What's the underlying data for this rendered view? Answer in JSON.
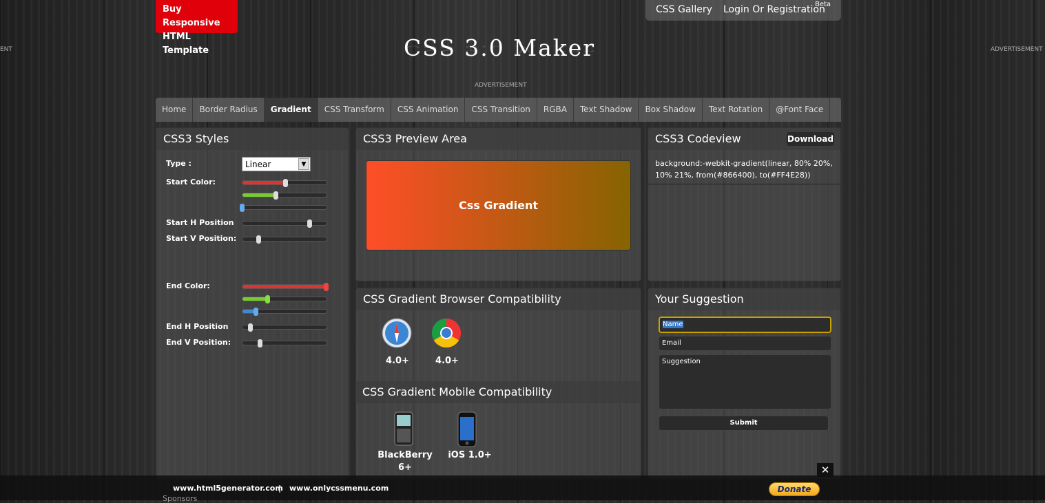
{
  "top": {
    "buy_line1": "Buy Responsive",
    "buy_line2": "HTML Template",
    "gallery": "CSS Gallery",
    "login": "Login Or Registration",
    "beta": "Beta"
  },
  "logo": {
    "text": "CSS 3.0 Maker"
  },
  "ads": {
    "center": "ADVERTISEMENT",
    "right": "ADVERTISEMENT",
    "left": "ENT"
  },
  "nav": {
    "items": [
      "Home",
      "Border Radius",
      "Gradient",
      "CSS Transform",
      "CSS Animation",
      "CSS Transition",
      "RGBA",
      "Text Shadow",
      "Box Shadow",
      "Text Rotation",
      "@Font Face"
    ],
    "active": "Gradient"
  },
  "styles_panel": {
    "title": "CSS3 Styles",
    "type_label": "Type :",
    "type_value": "Linear",
    "start_color_label": "Start Color:",
    "start_h_label": "Start H Position",
    "start_v_label": "Start V Position:",
    "end_color_label": "End Color:",
    "end_h_label": "End H Position",
    "end_v_label": "End V Position:",
    "start_color": {
      "r": 0.52,
      "g": 0.4,
      "b": 0.0
    },
    "start_h": 0.8,
    "start_v": 0.2,
    "end_color": {
      "r": 1.0,
      "g": 0.3,
      "b": 0.16
    },
    "end_h": 0.1,
    "end_v": 0.21
  },
  "preview": {
    "title": "CSS3 Preview Area",
    "text": "Css Gradient",
    "color_from": "#FF4E28",
    "color_to": "#866400"
  },
  "codeview": {
    "title": "CSS3 Codeview",
    "download": "Download",
    "code": "background:-webkit-gradient(linear, 80% 20%, 10% 21%, from(#866400), to(#FF4E28))"
  },
  "browser_compat": {
    "title": "CSS Gradient Browser Compatibility",
    "items": [
      {
        "icon": "safari-icon",
        "version": "4.0+"
      },
      {
        "icon": "chrome-icon",
        "version": "4.0+"
      }
    ]
  },
  "mobile_compat": {
    "title": "CSS Gradient Mobile Compatibility",
    "items": [
      {
        "icon": "blackberry-icon",
        "line1": "BlackBerry",
        "line2": "6+"
      },
      {
        "icon": "iphone-icon",
        "line1": "iOS 1.0+",
        "line2": ""
      }
    ]
  },
  "suggestion": {
    "title": "Your Suggestion",
    "name_value": "Name",
    "email_value": "Email",
    "suggestion_value": "Suggestion",
    "submit": "Submit"
  },
  "footer": {
    "link1": "www.html5generator.com",
    "sep": "|",
    "link2": "www.onlycssmenu.com",
    "donate": "Donate",
    "sponsors": "Sponsors",
    "close": "✕"
  }
}
